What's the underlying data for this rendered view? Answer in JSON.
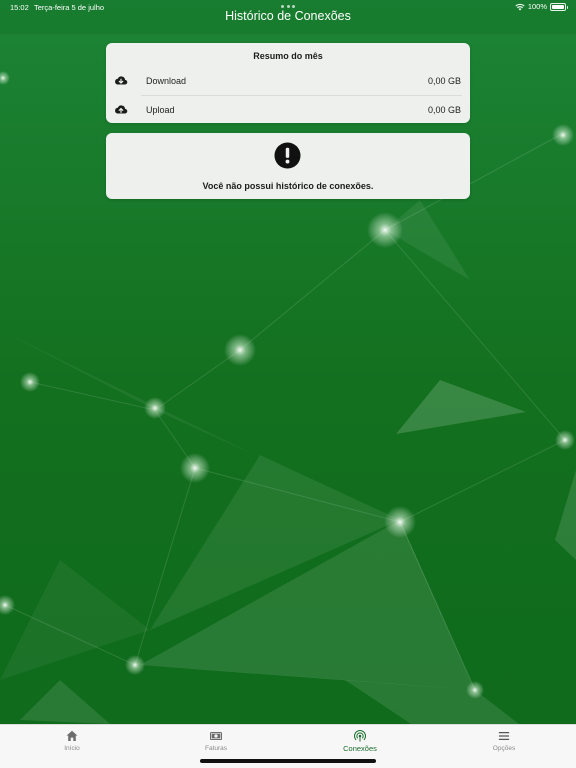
{
  "status_bar": {
    "time": "15:02",
    "date": "Terça-feira 5 de julho",
    "battery": "100%"
  },
  "nav": {
    "title": "Histórico de Conexões"
  },
  "summary": {
    "title": "Resumo do mês",
    "rows": [
      {
        "label": "Download",
        "value": "0,00 GB",
        "icon": "cloud-download-icon"
      },
      {
        "label": "Upload",
        "value": "0,00 GB",
        "icon": "cloud-upload-icon"
      }
    ]
  },
  "empty_state": {
    "icon": "exclamation-circle-icon",
    "message": "Você não possui histórico de conexões."
  },
  "tabs": [
    {
      "label": "Início",
      "icon": "home-icon",
      "active": false
    },
    {
      "label": "Faturas",
      "icon": "banknote-icon",
      "active": false
    },
    {
      "label": "Conexões",
      "icon": "signal-icon",
      "active": true
    },
    {
      "label": "Opções",
      "icon": "menu-icon",
      "active": false
    }
  ],
  "colors": {
    "background_green": "#136f26",
    "accent_green": "#1c6e2e",
    "card_background": "#eef0ee",
    "tab_inactive": "#8a8a8a"
  }
}
